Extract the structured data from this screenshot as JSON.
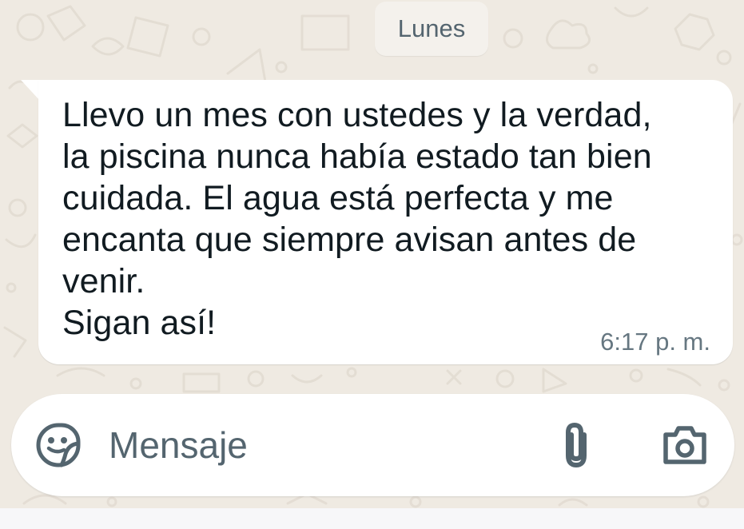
{
  "chat": {
    "date_separator": "Lunes",
    "message": {
      "text": "Llevo un mes con ustedes y la verdad,\nla piscina nunca había estado tan bien\ncuidada. El agua está perfecta y me\nencanta que siempre avisan antes de\nvenir.\nSigan así!",
      "time": "6:17 p. m."
    }
  },
  "composer": {
    "placeholder": "Mensaje",
    "icons": {
      "emoji": "sticker-icon",
      "attach": "paperclip-icon",
      "camera": "camera-icon"
    }
  },
  "colors": {
    "background": "#efeae2",
    "bubble": "#ffffff",
    "text": "#111b21",
    "secondary_text": "#667781",
    "icon": "#54656f"
  }
}
